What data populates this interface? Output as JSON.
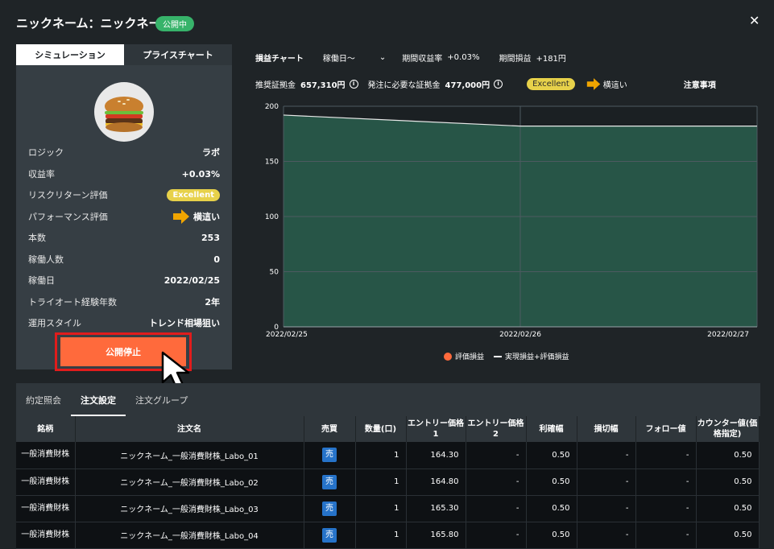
{
  "header": {
    "title": "ニックネーム：ニックネーム",
    "badge": "公開中"
  },
  "left_tabs": [
    "シミュレーション",
    "プライスチャート"
  ],
  "info": [
    {
      "label": "ロジック",
      "value": "ラボ"
    },
    {
      "label": "収益率",
      "value": "+0.03%"
    },
    {
      "label": "リスクリターン評価",
      "value": "Excellent"
    },
    {
      "label": "パフォーマンス評価",
      "value": "横這い"
    },
    {
      "label": "本数",
      "value": "253"
    },
    {
      "label": "稼働人数",
      "value": "0"
    },
    {
      "label": "稼働日",
      "value": "2022/02/25"
    },
    {
      "label": "トライオート経験年数",
      "value": "2年"
    },
    {
      "label": "運用スタイル",
      "value": "トレンド相場狙い"
    }
  ],
  "stop_button": "公開停止",
  "chart_header": {
    "title": "損益チャート",
    "period_select": "稼働日〜",
    "period_return_label": "期間収益率",
    "period_return_value": "+0.03%",
    "period_pl_label": "期間損益",
    "period_pl_value": "+181円",
    "margin_label": "推奨証拠金",
    "margin_value": "657,310円",
    "required_label": "発注に必要な証拠金",
    "required_value": "477,000円",
    "rating": "Excellent",
    "trend": "横這い",
    "notice": "注意事項"
  },
  "chart_data": {
    "type": "area",
    "x": [
      "2022/02/25",
      "2022/02/26",
      "2022/02/27"
    ],
    "series": [
      {
        "name": "評価損益",
        "values": [
          0,
          0,
          0
        ]
      },
      {
        "name": "実現損益+評価損益",
        "values": [
          192,
          182,
          182
        ]
      }
    ],
    "ylim": [
      0,
      200
    ],
    "yticks": [
      0,
      50,
      100,
      150,
      200
    ],
    "grid": true,
    "legend": "bottom",
    "colors": {
      "area": "#275547",
      "line": "#e8e8e8",
      "eval": "#ff6a3c"
    }
  },
  "bottom_tabs": [
    "約定照会",
    "注文設定",
    "注文グループ"
  ],
  "table": {
    "headers": [
      "銘柄",
      "注文名",
      "売買",
      "数量(口)",
      "エントリー価格1",
      "エントリー価格2",
      "利確幅",
      "損切幅",
      "フォロー値",
      "カウンター値(価格指定)"
    ],
    "rows": [
      {
        "symbol": "一般消費財株",
        "name": "ニックネーム_一般消費財株_Labo_01",
        "side": "売",
        "qty": "1",
        "entry1": "164.30",
        "entry2": "-",
        "tp": "0.50",
        "sl": "-",
        "follow": "-",
        "counter": "0.50"
      },
      {
        "symbol": "一般消費財株",
        "name": "ニックネーム_一般消費財株_Labo_02",
        "side": "売",
        "qty": "1",
        "entry1": "164.80",
        "entry2": "-",
        "tp": "0.50",
        "sl": "-",
        "follow": "-",
        "counter": "0.50"
      },
      {
        "symbol": "一般消費財株",
        "name": "ニックネーム_一般消費財株_Labo_03",
        "side": "売",
        "qty": "1",
        "entry1": "165.30",
        "entry2": "-",
        "tp": "0.50",
        "sl": "-",
        "follow": "-",
        "counter": "0.50"
      },
      {
        "symbol": "一般消費財株",
        "name": "ニックネーム_一般消費財株_Labo_04",
        "side": "売",
        "qty": "1",
        "entry1": "165.80",
        "entry2": "-",
        "tp": "0.50",
        "sl": "-",
        "follow": "-",
        "counter": "0.50"
      }
    ]
  }
}
